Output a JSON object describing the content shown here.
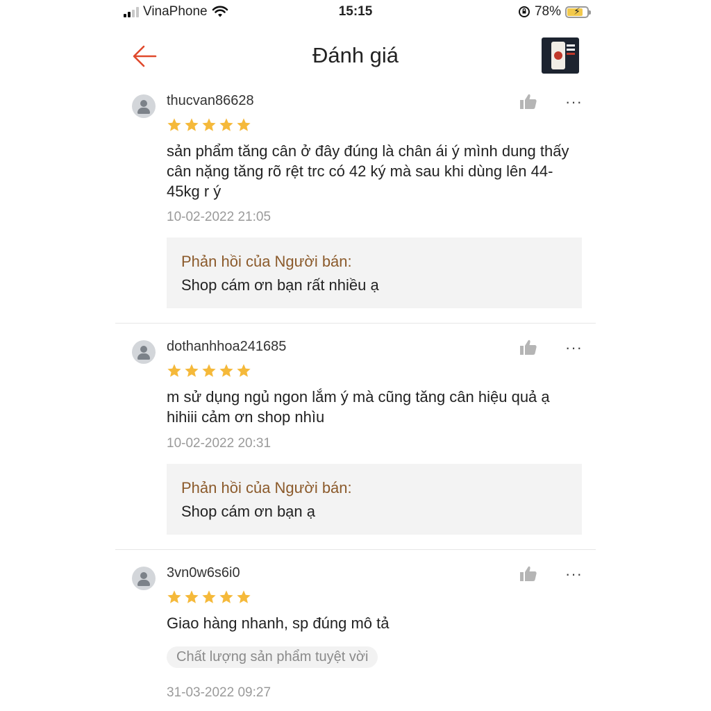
{
  "status_bar": {
    "carrier": "VinaPhone",
    "time": "15:15",
    "battery": "78%"
  },
  "header": {
    "title": "Đánh giá",
    "back_icon": "arrow-left-icon",
    "accent": "#e0492c"
  },
  "reviews": [
    {
      "username": "thucvan86628",
      "rating": 5,
      "content": "sản phẩm tăng cân ở đây đúng là chân ái ý mình dung thấy cân nặng tăng rõ rệt trc có 42 ký mà sau khi dùng lên 44-45kg r ý",
      "date": "10-02-2022 21:05",
      "reply_title": "Phản hồi của Người bán:",
      "reply_body": "Shop cám ơn bạn rất nhiều ạ"
    },
    {
      "username": "dothanhhoa241685",
      "rating": 5,
      "content": "m sử dụng ngủ ngon lắm ý mà cũng tăng cân  hiệu quả ạ hihiii cảm ơn shop nhìu",
      "date": "10-02-2022 20:31",
      "reply_title": "Phản hồi của Người bán:",
      "reply_body": "Shop cám ơn bạn ạ"
    },
    {
      "username": "3vn0w6s6i0",
      "rating": 5,
      "content": "Giao hàng nhanh, sp đúng mô tả",
      "tag": "Chất lượng sản phẩm tuyệt vời",
      "date": "31-03-2022 09:27"
    }
  ],
  "more_label": "···",
  "colors": {
    "star": "#f5b93a",
    "reply_title": "#8b5a2b",
    "date": "#9a9a9a"
  }
}
